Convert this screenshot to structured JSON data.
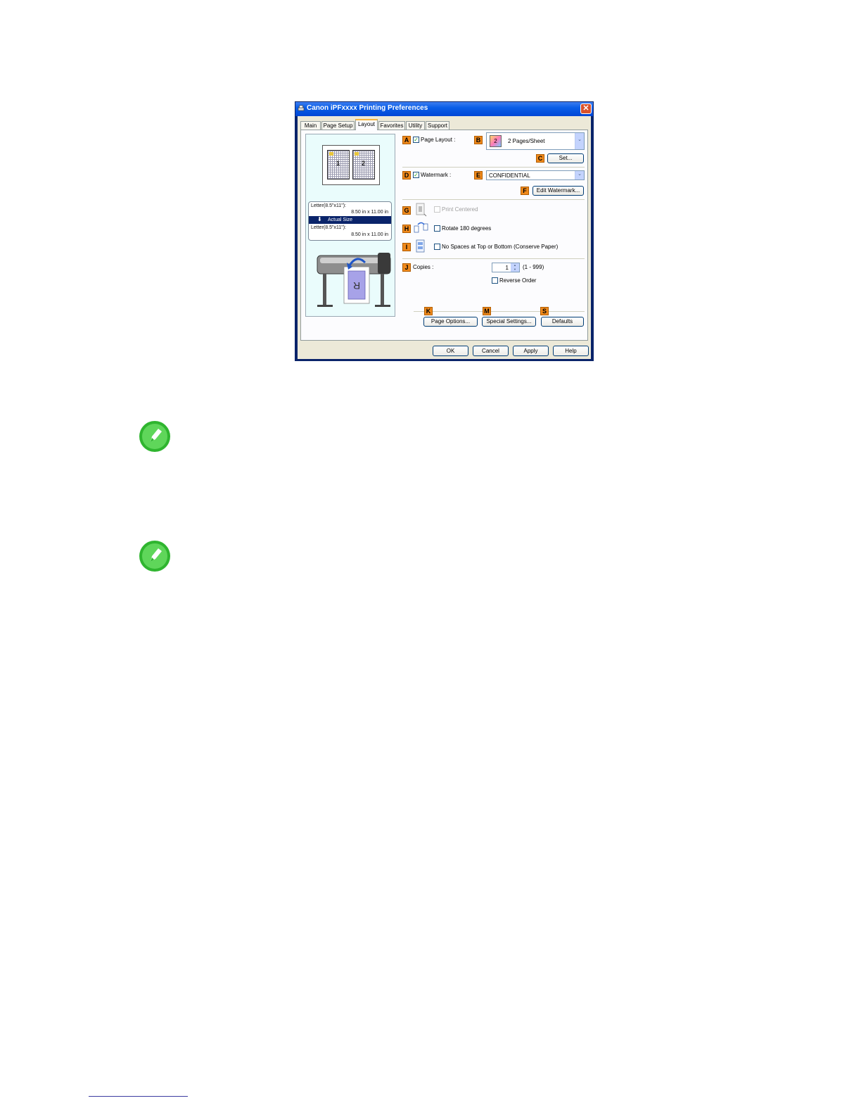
{
  "window": {
    "title": "Canon iPFxxxx Printing Preferences",
    "close": "✕"
  },
  "tabs": [
    {
      "label": "Main"
    },
    {
      "label": "Page Setup"
    },
    {
      "label": "Layout"
    },
    {
      "label": "Favorites"
    },
    {
      "label": "Utility"
    },
    {
      "label": "Support"
    }
  ],
  "preview": {
    "page1": "1",
    "page2": "2",
    "src_size": "Letter(8.5\"x11\"):",
    "src_dims": "8.50 in x 11.00 in",
    "scale": "Actual Size",
    "dst_size": "Letter(8.5\"x11\"):",
    "dst_dims": "8.50 in x 11.00 in",
    "printed_letter": "R"
  },
  "tags": {
    "a": "A",
    "b": "B",
    "c": "C",
    "d": "D",
    "e": "E",
    "f": "F",
    "g": "G",
    "h": "H",
    "i": "I",
    "j": "J",
    "k": "K",
    "m": "M",
    "s": "S"
  },
  "layout": {
    "page_layout_label": "Page Layout :",
    "page_layout_checked": true,
    "pages_per_sheet_value": "2 Pages/Sheet",
    "pages_icon_num": "2",
    "set_button": "Set...",
    "watermark_label": "Watermark :",
    "watermark_checked": true,
    "watermark_value": "CONFIDENTIAL",
    "edit_watermark_button": "Edit Watermark...",
    "print_centered_label": "Print Centered",
    "rotate_label": "Rotate 180 degrees",
    "no_spaces_label": "No Spaces at Top or Bottom (Conserve Paper)",
    "copies_label": "Copies :",
    "copies_value": "1",
    "copies_range": "(1 - 999)",
    "reverse_order_label": "Reverse Order"
  },
  "buttons": {
    "page_options": "Page Options...",
    "special_settings": "Special Settings...",
    "defaults": "Defaults",
    "ok": "OK",
    "cancel": "Cancel",
    "apply": "Apply",
    "help": "Help"
  },
  "icons": {
    "check": "✓",
    "dropdown": "⌄",
    "spin_up": "▲",
    "spin_down": "▼",
    "arrow_down": "⬇",
    "close": "✕"
  }
}
